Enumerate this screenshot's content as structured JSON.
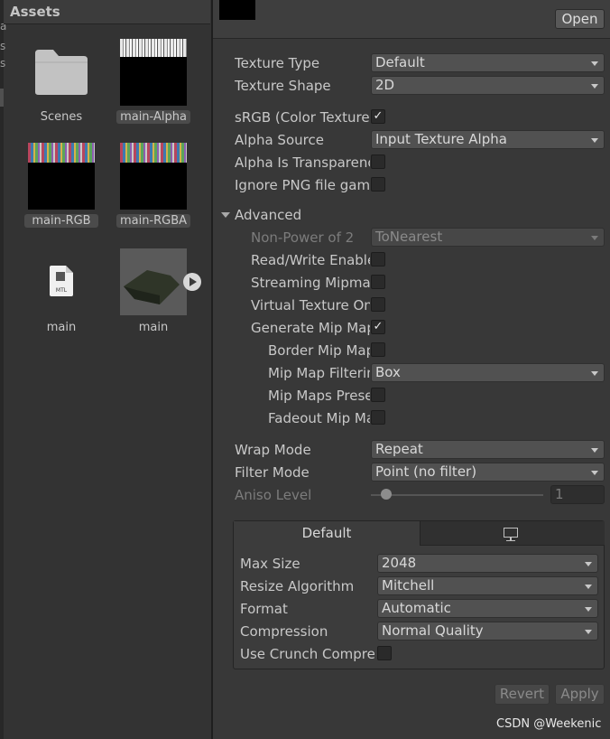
{
  "assets_panel": {
    "title": "Assets",
    "left_fragments": [
      "a",
      "s",
      "s"
    ],
    "items": [
      {
        "label": "Scenes",
        "icon": "folder-icon"
      },
      {
        "label": "main-Alpha",
        "icon": "texture-thumbnail"
      },
      {
        "label": "main-RGB",
        "icon": "texture-thumbnail"
      },
      {
        "label": "main-RGBA",
        "icon": "texture-thumbnail"
      },
      {
        "label": "main",
        "icon": "mtl-file-icon",
        "icon_text": "MTL"
      },
      {
        "label": "main",
        "icon": "model-thumbnail"
      }
    ]
  },
  "inspector": {
    "open_button": "Open",
    "texture_type": {
      "label": "Texture Type",
      "value": "Default"
    },
    "texture_shape": {
      "label": "Texture Shape",
      "value": "2D"
    },
    "srgb": {
      "label": "sRGB (Color Texture)",
      "checked": true
    },
    "alpha_source": {
      "label": "Alpha Source",
      "value": "Input Texture Alpha"
    },
    "alpha_is_transparency": {
      "label": "Alpha Is Transparency",
      "checked": false
    },
    "ignore_png_gamma": {
      "label": "Ignore PNG file gamma",
      "checked": false
    },
    "advanced": {
      "label": "Advanced",
      "non_power_of_2": {
        "label": "Non-Power of 2",
        "value": "ToNearest"
      },
      "read_write": {
        "label": "Read/Write Enabled",
        "checked": false
      },
      "streaming_mipmaps": {
        "label": "Streaming Mipmaps",
        "checked": false
      },
      "virtual_texture_only": {
        "label": "Virtual Texture Only",
        "checked": false
      },
      "generate_mip_maps": {
        "label": "Generate Mip Maps",
        "checked": true
      },
      "border_mip_maps": {
        "label": "Border Mip Maps",
        "checked": false
      },
      "mip_map_filtering": {
        "label": "Mip Map Filtering",
        "value": "Box"
      },
      "mip_maps_preserve_coverage": {
        "label": "Mip Maps Preserve Coverage",
        "checked": false
      },
      "fadeout_mip_maps": {
        "label": "Fadeout Mip Maps",
        "checked": false
      }
    },
    "wrap_mode": {
      "label": "Wrap Mode",
      "value": "Repeat"
    },
    "filter_mode": {
      "label": "Filter Mode",
      "value": "Point (no filter)"
    },
    "aniso_level": {
      "label": "Aniso Level",
      "value": "1",
      "level_fraction": 0.0
    },
    "platform": {
      "tabs": [
        "Default",
        "monitor-icon"
      ],
      "max_size": {
        "label": "Max Size",
        "value": "2048"
      },
      "resize_algorithm": {
        "label": "Resize Algorithm",
        "value": "Mitchell"
      },
      "format": {
        "label": "Format",
        "value": "Automatic"
      },
      "compression": {
        "label": "Compression",
        "value": "Normal Quality"
      },
      "use_crunch": {
        "label": "Use Crunch Compression",
        "checked": false
      }
    },
    "revert_button": "Revert",
    "apply_button": "Apply"
  },
  "watermark": "CSDN @Weekenic",
  "colors": {
    "panel_bg": "#383838",
    "assets_bg": "#333333",
    "selected_label_bg": "#4b4b4b"
  }
}
